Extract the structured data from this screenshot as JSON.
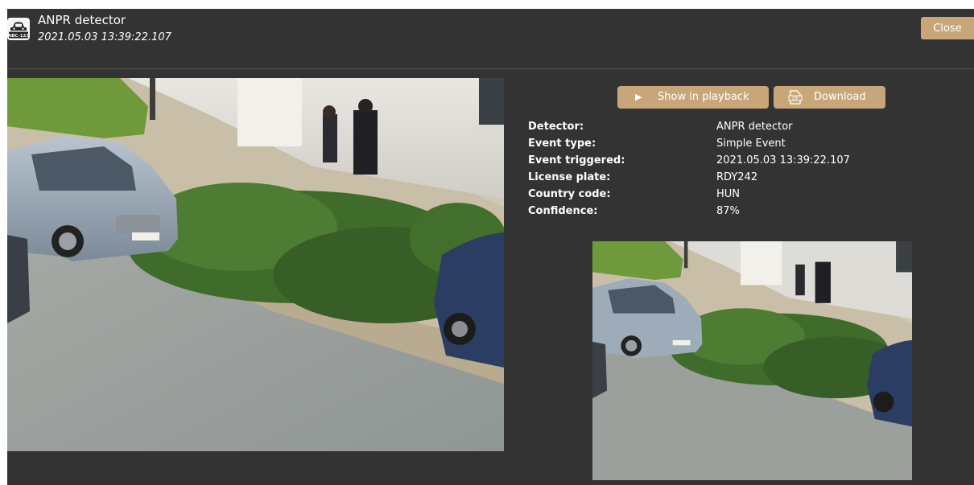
{
  "header": {
    "title": "ANPR detector",
    "timestamp": "2021.05.03 13:39:22.107",
    "icon": "anpr-plate-icon",
    "icon_text": "ABC-123",
    "close_label": "Close"
  },
  "actions": {
    "show_in_playback_label": "Show in playback",
    "show_in_playback_icon": "play-icon",
    "download_label": "Download",
    "download_icon": "zip-file-icon",
    "download_icon_text": "ZIP"
  },
  "details": [
    {
      "label": "Detector:",
      "value": "ANPR detector"
    },
    {
      "label": "Event type:",
      "value": "Simple Event"
    },
    {
      "label": "Event triggered:",
      "value": "2021.05.03 13:39:22.107"
    },
    {
      "label": "License plate:",
      "value": "RDY242"
    },
    {
      "label": "Country code:",
      "value": "HUN"
    },
    {
      "label": "Confidence:",
      "value": "87%"
    }
  ],
  "images": {
    "plate_text": "RDY-242"
  },
  "colors": {
    "panel_background": "#333333",
    "button_accent": "#c8a67a",
    "text": "#ffffff"
  }
}
